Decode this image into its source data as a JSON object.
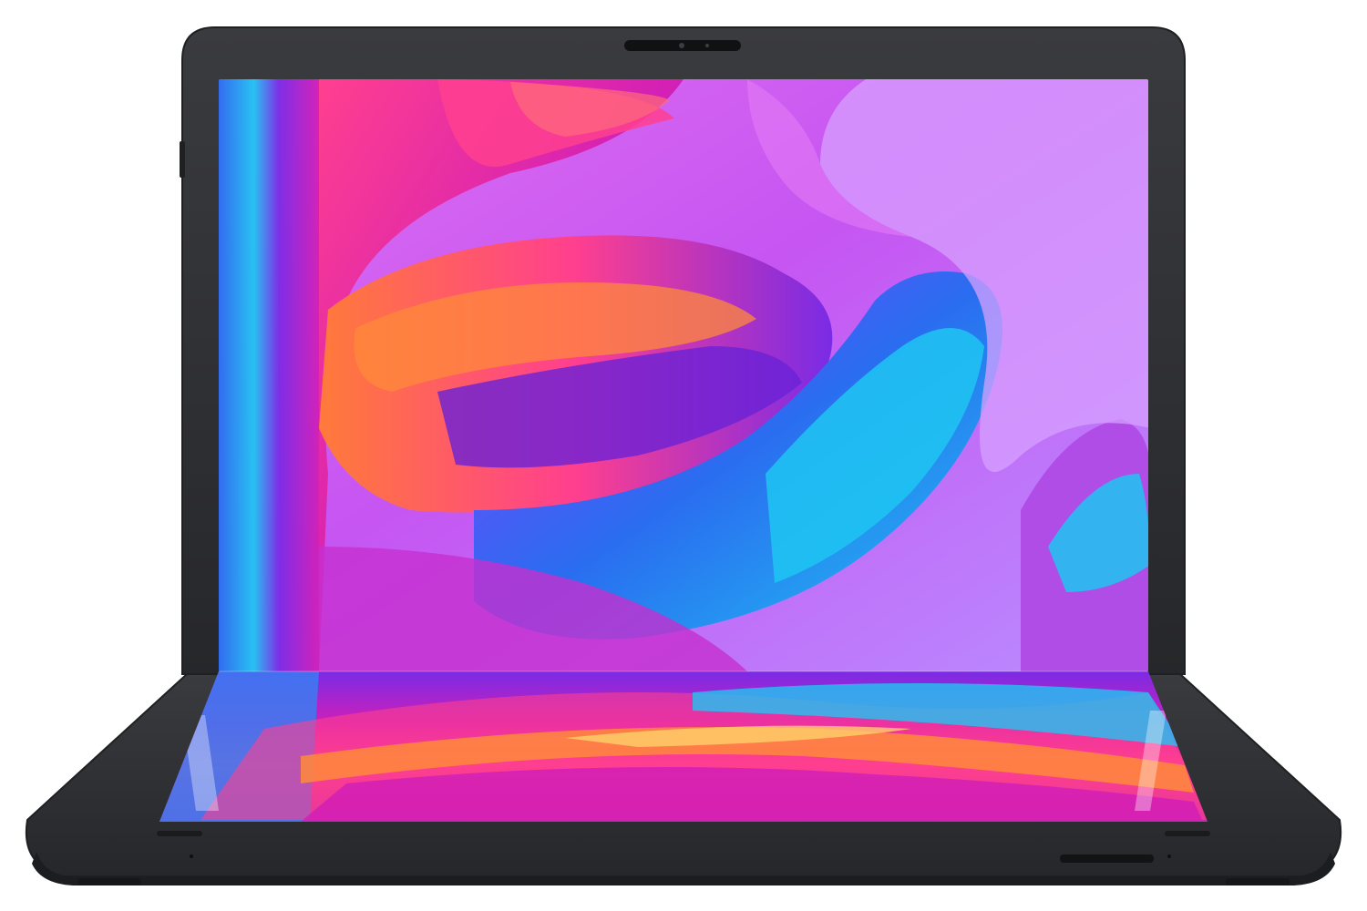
{
  "palette": {
    "background": "#ffffff",
    "bezel": "#2f3033",
    "bezel_edge": "#1f2022",
    "wallpaper_base": "#c655f2",
    "wallpaper_magenta": "#d21fb6",
    "wallpaper_pink": "#ff3f8f",
    "wallpaper_orange": "#ff7a3a",
    "wallpaper_cyan": "#1fc6f2",
    "wallpaper_blue": "#2a6df0",
    "wallpaper_violet": "#7a2be6",
    "wallpaper_lilac": "#d7a0ff"
  },
  "device": {
    "type": "foldable laptop",
    "icons": {
      "webcam": "webcam-icon",
      "speaker_left": "speaker-grille-icon",
      "speaker_right": "speaker-grille-icon",
      "mic": "microphone-hole-icon",
      "port": "usb-c-port-icon"
    }
  }
}
